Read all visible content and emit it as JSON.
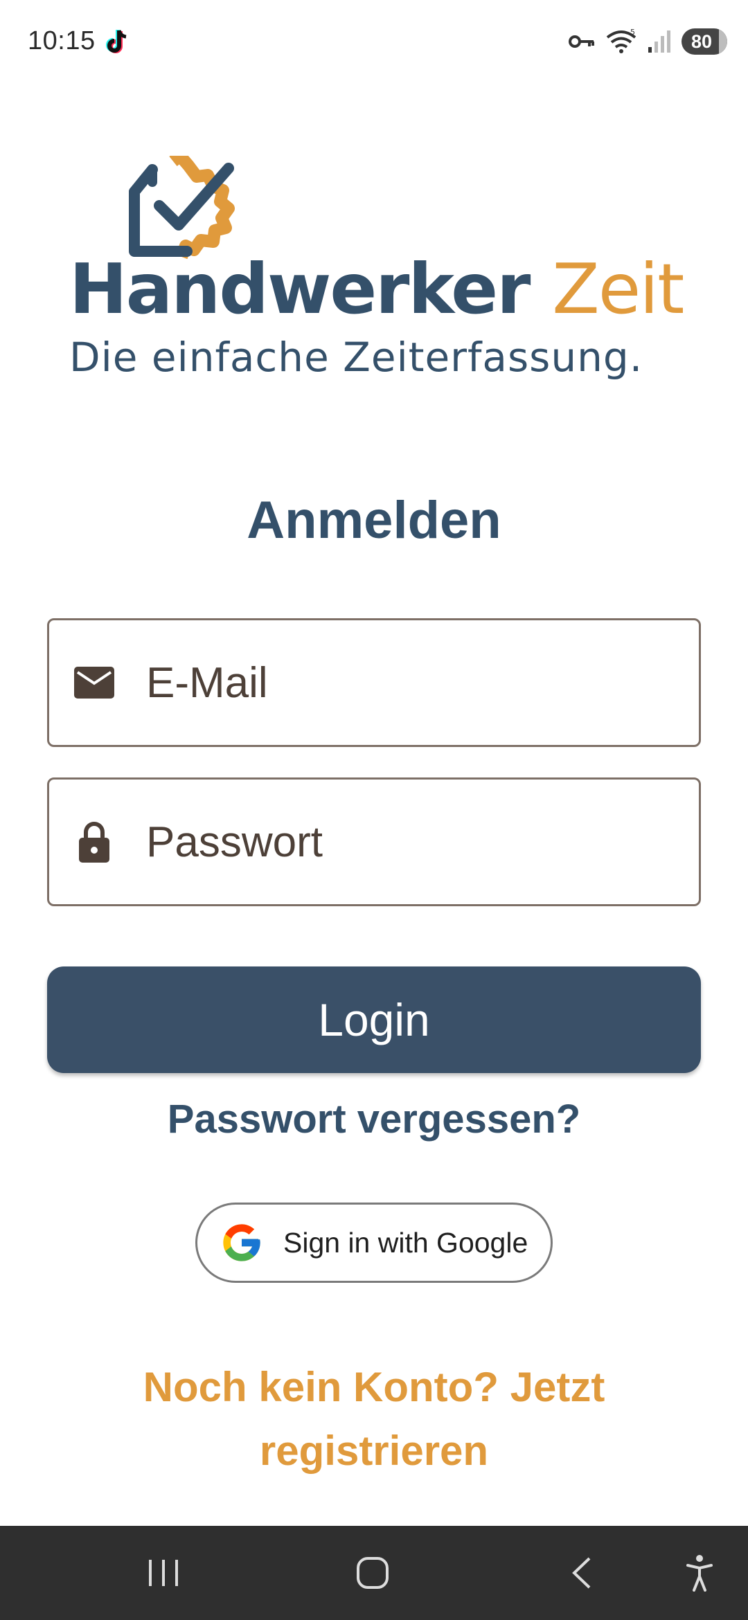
{
  "status_bar": {
    "time": "10:15",
    "battery": "80",
    "icons": [
      "tiktok-icon",
      "vpn-key-icon",
      "wifi-icon",
      "signal-icon",
      "battery-icon"
    ]
  },
  "logo": {
    "word1": "Handwerker",
    "word2": "Zeit",
    "tagline": "Die einfache Zeiterfassung.",
    "colors": {
      "primary": "#34506a",
      "accent": "#e09a3c"
    }
  },
  "login": {
    "title": "Anmelden",
    "email_placeholder": "E-Mail",
    "password_placeholder": "Passwort",
    "login_label": "Login",
    "forgot_label": "Passwort vergessen?",
    "google_label": "Sign in with Google",
    "register_label": "Noch kein Konto? Jetzt registrieren"
  },
  "nav_bar": {
    "buttons": [
      "recents-icon",
      "home-icon",
      "back-icon",
      "accessibility-icon"
    ]
  }
}
